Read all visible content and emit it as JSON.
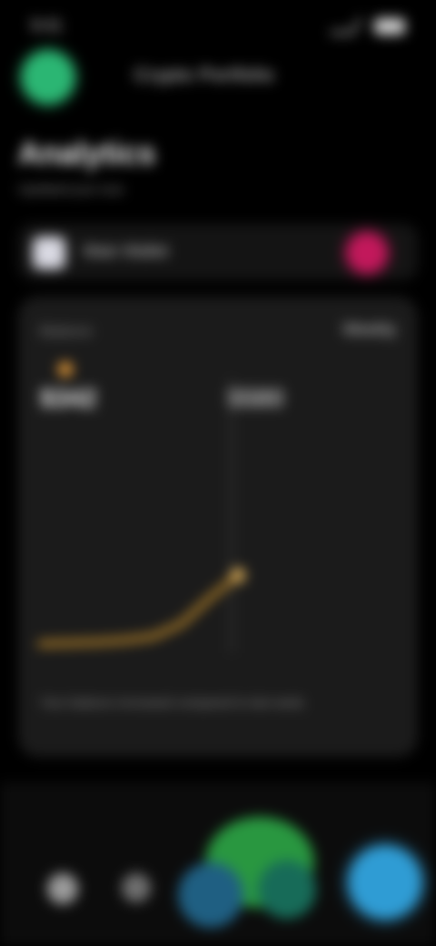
{
  "status_bar": {
    "time": "9:41"
  },
  "header": {
    "title": "Crypto Portfolio"
  },
  "page": {
    "title": "Analytics",
    "subtitle": "Updated just now"
  },
  "account": {
    "label": "Main Wallet",
    "badge_color": "#c2185b"
  },
  "card": {
    "label": "Balance",
    "action": "Weekly",
    "left_stat": "$342",
    "right_stat": "$580",
    "footer": "Your balance increased compared to last week."
  },
  "chart_data": {
    "type": "line",
    "x": [
      1,
      2,
      3,
      4,
      5,
      6,
      7,
      8
    ],
    "series": [
      {
        "values": [
          1.0,
          1.1,
          1.2,
          1.4,
          1.8,
          3.2,
          6.0,
          8.5
        ],
        "color": "#c9902b"
      }
    ],
    "ylim": [
      0,
      30
    ],
    "grid": false
  },
  "bottom_nav": {
    "items": [
      "home-icon",
      "search-icon",
      "wallet-icon",
      "chart-icon"
    ],
    "fab_color": "#2f9cd4"
  }
}
